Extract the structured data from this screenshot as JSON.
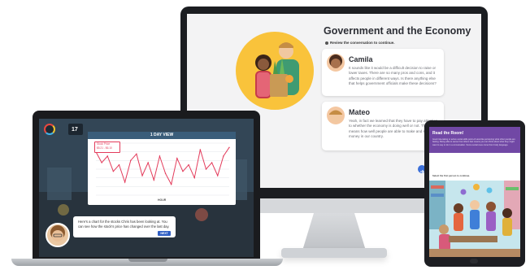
{
  "imac": {
    "title": "Government and the Economy",
    "instruction": "Review the conversation to continue.",
    "cards": [
      {
        "name": "Camila",
        "text": "It sounds like it would be a difficult decision to raise or lower taxes. There are so many pros and cons, and it affects people in different ways. Is there anything else that helps government officials make these decisions?"
      },
      {
        "name": "Mateo",
        "text": "Yeah, in fact we learned that they have to pay attention to whether the economy is doing well or not. That means how well people are able to make and spend money in our country."
      }
    ],
    "next_icon": "arrow-right-icon"
  },
  "laptop": {
    "stat_value": "17",
    "chart_title": "1 DAY VIEW",
    "legend_label": "Stock Price",
    "legend_range": "$5.21 - $6.10",
    "x_axis_label": "HOUR",
    "chat_text": "Here's a chart for the stocks Chris has been looking at. You can see how the stock's price has changed over the last day.",
    "chat_button": "NEXT",
    "chart_color": "#e33b5b"
  },
  "tablet": {
    "title": "Read the Room!",
    "body": "Good role-taking or active social skills point-of-view like perceiving what other people are feeling. Being able to sense how others feel means you can think about what they might want to say or do in a conversation. Some social cues come from body language.",
    "instruction": "Select the first person to continue.",
    "accent": "#7148a5"
  },
  "chart_data": {
    "type": "line",
    "title": "1 DAY VIEW",
    "xlabel": "HOUR",
    "ylabel": "",
    "x": [
      0,
      1,
      2,
      3,
      4,
      5,
      6,
      7,
      8,
      9,
      10,
      11,
      12,
      13,
      14,
      15,
      16,
      17,
      18,
      19,
      20,
      21,
      22,
      23
    ],
    "series": [
      {
        "name": "Stock Price",
        "values": [
          6.0,
          5.75,
          5.9,
          5.55,
          5.7,
          5.3,
          5.8,
          5.95,
          5.45,
          5.75,
          5.35,
          5.9,
          5.5,
          5.25,
          5.85,
          5.55,
          5.7,
          5.4,
          6.05,
          5.6,
          5.75,
          5.45,
          5.9,
          6.1
        ]
      }
    ],
    "ylim": [
      5.0,
      6.2
    ],
    "grid": true
  }
}
